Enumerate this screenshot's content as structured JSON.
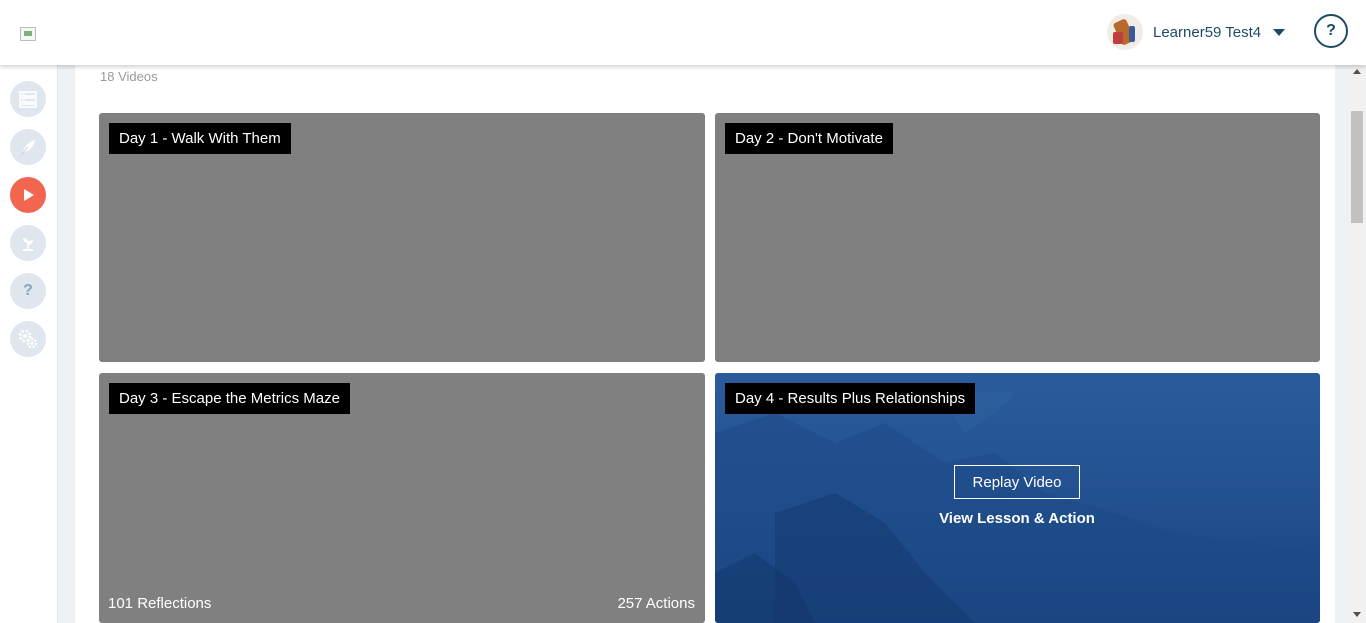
{
  "header": {
    "user_name": "Learner59 Test4",
    "help_label": "?",
    "icons": {
      "logo": "broken-image-icon",
      "dropdown": "caret-down-icon"
    }
  },
  "sidebar": {
    "items": [
      {
        "icon": "list-icon",
        "active": false
      },
      {
        "icon": "feather-icon",
        "active": false
      },
      {
        "icon": "play-icon",
        "active": true
      },
      {
        "icon": "sprout-icon",
        "active": false
      },
      {
        "icon": "question-icon",
        "label": "?",
        "active": false
      },
      {
        "icon": "gears-icon",
        "active": false
      }
    ]
  },
  "main": {
    "video_count": "18 Videos",
    "videos": [
      {
        "title": "Day 1 - Walk With Them"
      },
      {
        "title": "Day 2 - Don't Motivate"
      },
      {
        "title": "Day 3 - Escape the Metrics Maze",
        "reflections": "101 Reflections",
        "actions": "257 Actions"
      },
      {
        "title": "Day 4 - Results Plus Relationships",
        "replay_label": "Replay Video",
        "view_label": "View Lesson & Action"
      }
    ]
  },
  "colors": {
    "accent": "#f2664f",
    "nav_icon_bg": "#dfe6ee",
    "brand_text": "#1d4b66",
    "card_gray": "#808080",
    "card_blue": "#22508f"
  }
}
